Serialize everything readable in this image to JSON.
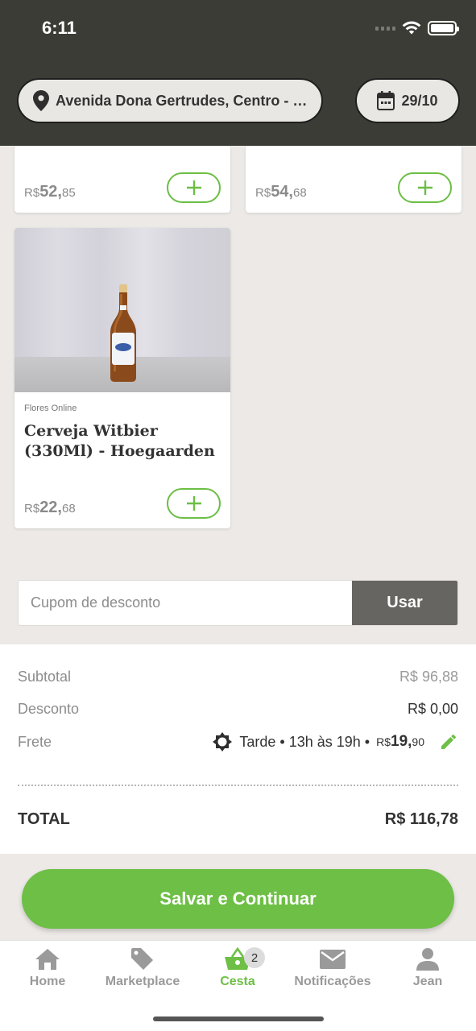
{
  "status_bar": {
    "time": "6:11"
  },
  "header": {
    "address": "Avenida Dona Gertrudes, Centro - São Paulo",
    "date": "29/10",
    "icons": {
      "location": "location-pin-icon",
      "calendar": "calendar-icon"
    }
  },
  "products": [
    {
      "price_currency": "R$",
      "price_int": "52,",
      "price_dec": "85"
    },
    {
      "price_currency": "R$",
      "price_int": "54,",
      "price_dec": "68"
    },
    {
      "store": "Flores Online",
      "name": "Cerveja Witbier (330Ml) - Hoegaarden",
      "price_currency": "R$",
      "price_int": "22,",
      "price_dec": "68"
    }
  ],
  "coupon": {
    "placeholder": "Cupom de desconto",
    "button": "Usar"
  },
  "summary": {
    "subtotal_label": "Subtotal",
    "subtotal_value": "R$ 96,88",
    "discount_label": "Desconto",
    "discount_value": "R$ 0,00",
    "shipping_label": "Frete",
    "shipping_desc": "Tarde • 13h às 19h •",
    "shipping_currency": "R$",
    "shipping_int": "19,",
    "shipping_dec": "90",
    "total_label": "TOTAL",
    "total_value": "R$ 116,78"
  },
  "actions": {
    "save": "Salvar e Continuar"
  },
  "tabbar": {
    "items": [
      {
        "label": "Home",
        "icon": "home-icon"
      },
      {
        "label": "Marketplace",
        "icon": "tag-icon"
      },
      {
        "label": "Cesta",
        "icon": "basket-icon",
        "badge": "2"
      },
      {
        "label": "Notificações",
        "icon": "envelope-icon"
      },
      {
        "label": "Jean",
        "icon": "user-icon"
      }
    ],
    "active": "Cesta"
  },
  "colors": {
    "accent": "#6dbf45",
    "header_bg": "#3c3c37",
    "page_bg": "#ece9e6"
  }
}
